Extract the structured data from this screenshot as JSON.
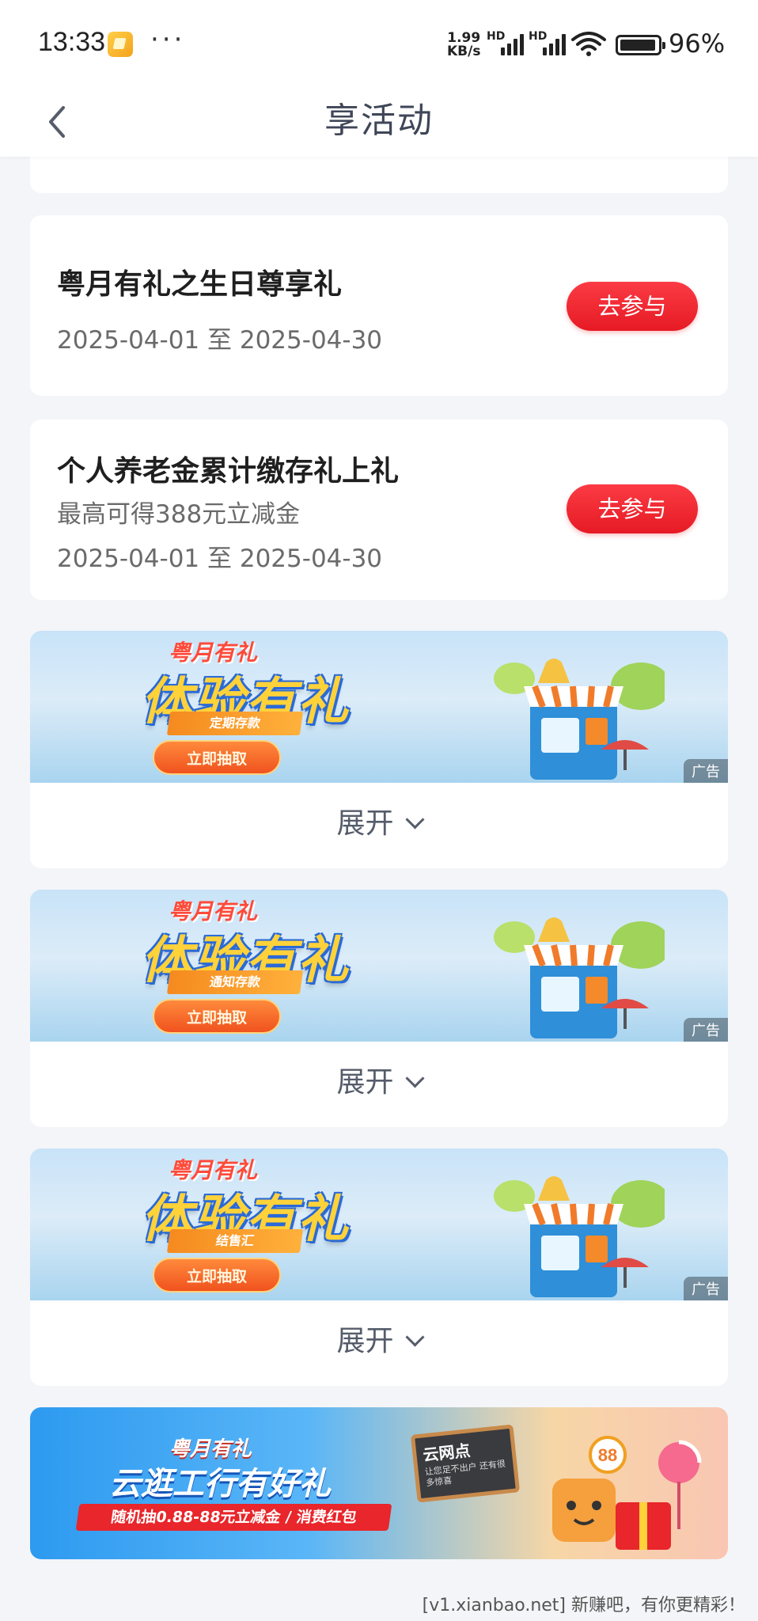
{
  "status_bar": {
    "time": "13:33",
    "net_speed_value": "1.99",
    "net_speed_unit": "KB/s",
    "signal_labels": [
      "HD",
      "HD"
    ],
    "battery": "96%"
  },
  "header": {
    "title": "享活动",
    "back_icon": "back-arrow-icon"
  },
  "activities": [
    {
      "title": "粤月有礼之生日尊享礼",
      "subtitle": "",
      "date_range": "2025-04-01 至 2025-04-30",
      "button_label": "去参与"
    },
    {
      "title": "个人养老金累计缴存礼上礼",
      "subtitle": "最高可得388元立减金",
      "date_range": "2025-04-01 至 2025-04-30",
      "button_label": "去参与"
    }
  ],
  "promos": [
    {
      "brand": "粤月有礼",
      "headline": "体验有礼",
      "product": "定期存款",
      "cta": "立即抽取",
      "ad_label": "广告",
      "expand_label": "展开"
    },
    {
      "brand": "粤月有礼",
      "headline": "体验有礼",
      "product": "通知存款",
      "cta": "立即抽取",
      "ad_label": "广告",
      "expand_label": "展开"
    },
    {
      "brand": "粤月有礼",
      "headline": "体验有礼",
      "product": "结售汇",
      "cta": "立即抽取",
      "ad_label": "广告",
      "expand_label": "展开"
    }
  ],
  "bottom_banner": {
    "brand": "粤月有礼",
    "headline": "云逛工行有好礼",
    "offer": "随机抽0.88-88元立减金 / 消费红包",
    "board_title": "云网点",
    "board_text": "让您足不出户 还有很多惊喜",
    "badge": "88"
  },
  "watermark": "[v1.xianbao.net] 新赚吧，有你更精彩！",
  "colors": {
    "accent_red": "#e61a24",
    "background": "#f4f5f8"
  }
}
